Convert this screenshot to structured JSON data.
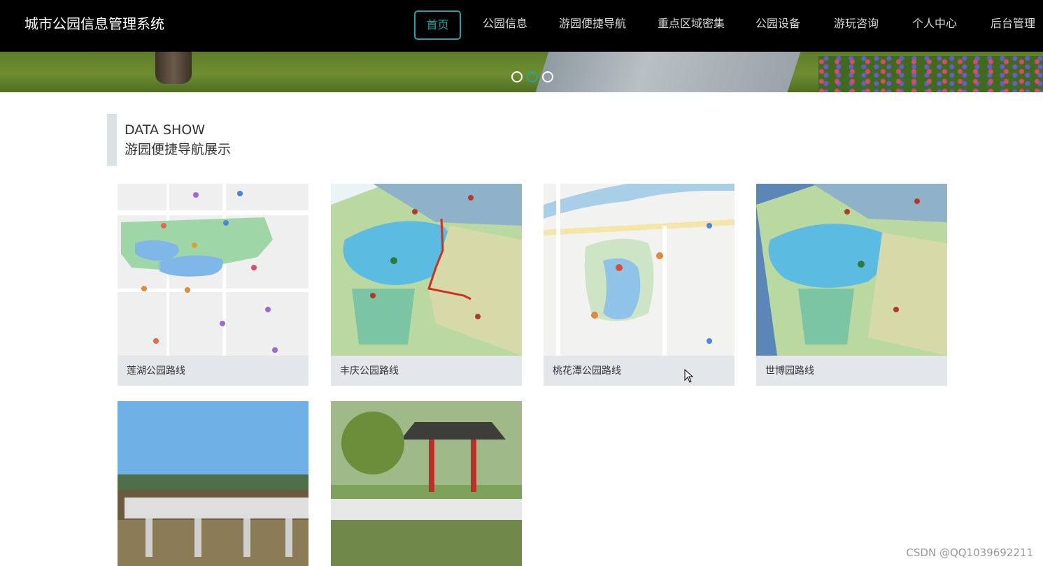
{
  "app": {
    "title": "城市公园信息管理系统"
  },
  "nav": {
    "items": [
      {
        "label": "首页",
        "active": true
      },
      {
        "label": "公园信息"
      },
      {
        "label": "游园便捷导航"
      },
      {
        "label": "重点区域密集"
      },
      {
        "label": "公园设备"
      },
      {
        "label": "游玩咨询"
      },
      {
        "label": "个人中心"
      },
      {
        "label": "后台管理"
      }
    ]
  },
  "carousel": {
    "slides": 3,
    "active_index": 1
  },
  "section": {
    "title_en": "DATA SHOW",
    "title_cn": "游园便捷导航展示"
  },
  "cards": [
    {
      "caption": "莲湖公园路线"
    },
    {
      "caption": "丰庆公园路线"
    },
    {
      "caption": "桃花潭公园路线"
    },
    {
      "caption": "世博园路线"
    }
  ],
  "watermark": "CSDN @QQ1039692211",
  "colors": {
    "accent": "#1fa5a8",
    "topbar": "#000000",
    "caption_bg": "#e4e7ea"
  }
}
